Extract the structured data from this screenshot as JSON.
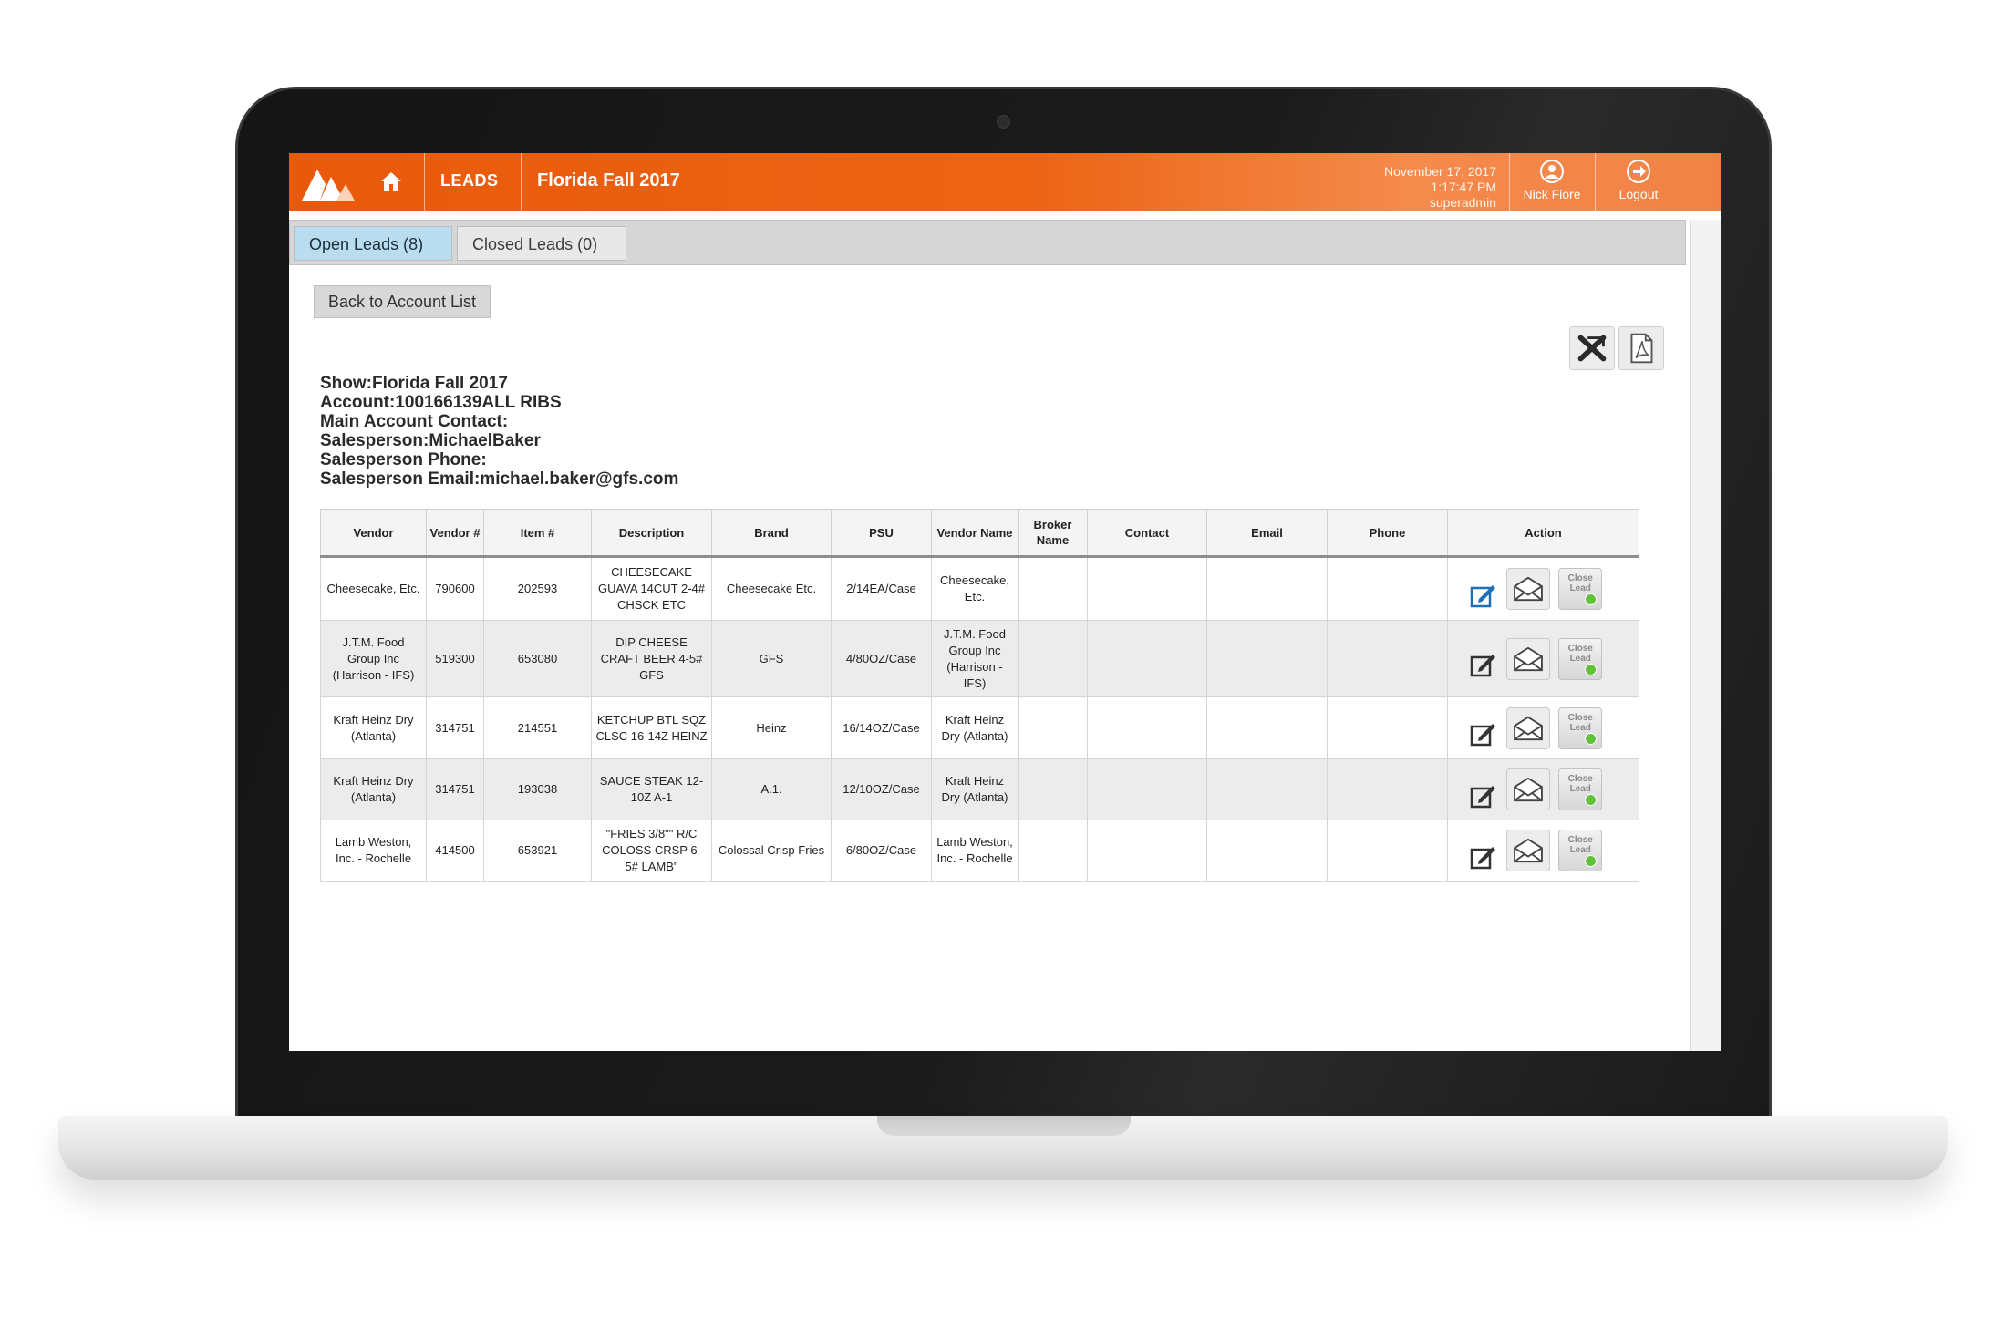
{
  "header": {
    "nav_leads": "LEADS",
    "show_title": "Florida Fall 2017",
    "date": "November 17, 2017",
    "time": "1:17:47 PM",
    "role": "superadmin",
    "user_name": "Nick Fiore",
    "logout_label": "Logout",
    "accent_color": "#e9590c"
  },
  "tabs": [
    {
      "label": "Open Leads (8)"
    },
    {
      "label": "Closed Leads (0)"
    }
  ],
  "back_button": "Back to Account List",
  "info_lines": [
    "Show:Florida Fall 2017",
    "Account:100166139ALL RIBS",
    "Main Account Contact:",
    "Salesperson:MichaelBaker",
    "Salesperson Phone:",
    "Salesperson Email:michael.baker@gfs.com"
  ],
  "columns": [
    "Vendor",
    "Vendor #",
    "Item #",
    "Description",
    "Brand",
    "PSU",
    "Vendor Name",
    "Broker Name",
    "Contact",
    "Email",
    "Phone",
    "Action"
  ],
  "close_lead_label_1": "Close",
  "close_lead_label_2": "Lead",
  "rows": [
    {
      "vendor": "Cheesecake, Etc.",
      "vendor_no": "790600",
      "item_no": "202593",
      "description": "CHEESECAKE GUAVA 14CUT 2-4# CHSCK ETC",
      "brand": "Cheesecake Etc.",
      "psu": "2/14EA/Case",
      "vendor_name": "Cheesecake, Etc.",
      "broker": "",
      "contact": "",
      "email": "",
      "phone": ""
    },
    {
      "vendor": "J.T.M. Food Group Inc (Harrison - IFS)",
      "vendor_no": "519300",
      "item_no": "653080",
      "description": "DIP CHEESE CRAFT BEER 4-5# GFS",
      "brand": "GFS",
      "psu": "4/80OZ/Case",
      "vendor_name": "J.T.M. Food Group Inc (Harrison - IFS)",
      "broker": "",
      "contact": "",
      "email": "",
      "phone": ""
    },
    {
      "vendor": "Kraft Heinz Dry (Atlanta)",
      "vendor_no": "314751",
      "item_no": "214551",
      "description": "KETCHUP BTL SQZ CLSC 16-14Z HEINZ",
      "brand": "Heinz",
      "psu": "16/14OZ/Case",
      "vendor_name": "Kraft Heinz Dry (Atlanta)",
      "broker": "",
      "contact": "",
      "email": "",
      "phone": ""
    },
    {
      "vendor": "Kraft Heinz Dry (Atlanta)",
      "vendor_no": "314751",
      "item_no": "193038",
      "description": "SAUCE STEAK 12-10Z A-1",
      "brand": "A.1.",
      "psu": "12/10OZ/Case",
      "vendor_name": "Kraft Heinz Dry (Atlanta)",
      "broker": "",
      "contact": "",
      "email": "",
      "phone": ""
    },
    {
      "vendor": "Lamb Weston, Inc. - Rochelle",
      "vendor_no": "414500",
      "item_no": "653921",
      "description": "\"FRIES 3/8\"\" R/C COLOSS CRSP 6-5# LAMB\"",
      "brand": "Colossal Crisp Fries",
      "psu": "6/80OZ/Case",
      "vendor_name": "Lamb Weston, Inc. - Rochelle",
      "broker": "",
      "contact": "",
      "email": "",
      "phone": ""
    }
  ]
}
